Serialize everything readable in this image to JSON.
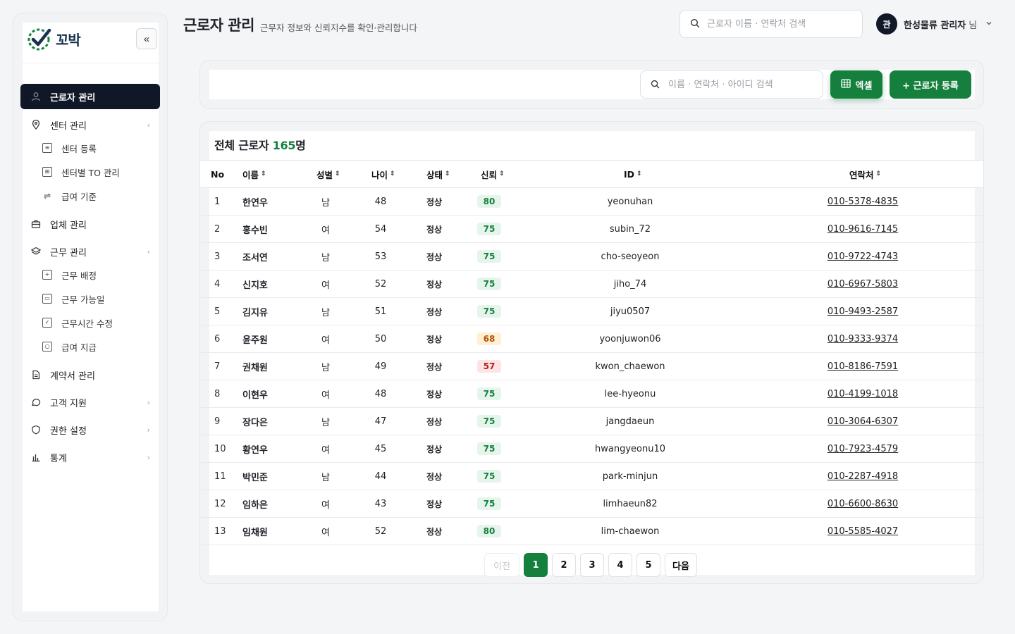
{
  "brand": {
    "name": "꼬박"
  },
  "sidebar": {
    "collapse_label": "«",
    "items": [
      {
        "label": "근로자 관리",
        "icon": "user-icon",
        "active": true
      },
      {
        "label": "센터 관리",
        "icon": "map-pin-icon",
        "chevron": "‹"
      },
      {
        "label": "센터 등록",
        "icon": "document-icon",
        "sub": true
      },
      {
        "label": "센터별 TO 관리",
        "icon": "table-icon",
        "sub": true
      },
      {
        "label": "급여 기준",
        "icon": "sliders-icon",
        "sub": true
      },
      {
        "label": "업체 관리",
        "icon": "briefcase-icon"
      },
      {
        "label": "근무 관리",
        "icon": "layers-icon",
        "chevron": "‹"
      },
      {
        "label": "근무 배정",
        "icon": "plus-square-icon",
        "sub": true
      },
      {
        "label": "근무 가능일",
        "icon": "calendar-icon",
        "sub": true
      },
      {
        "label": "근무시간 수정",
        "icon": "check-square-icon",
        "sub": true
      },
      {
        "label": "급여 지급",
        "icon": "cash-icon",
        "sub": true
      },
      {
        "label": "계약서 관리",
        "icon": "file-icon"
      },
      {
        "label": "고객 지원",
        "icon": "chat-icon",
        "chevron": "›"
      },
      {
        "label": "권한 설정",
        "icon": "shield-icon",
        "chevron": "›"
      },
      {
        "label": "통계",
        "icon": "bar-chart-icon",
        "chevron": "›"
      }
    ]
  },
  "header": {
    "title": "근로자 관리",
    "subtitle": "근무자 정보와 신뢰지수를 확인·관리합니다",
    "search_placeholder": "근로자 이름 · 연락처 검색",
    "user_initial": "관",
    "user_name": "한성물류 관리자",
    "user_suffix": "님"
  },
  "toolbar": {
    "search_placeholder": "이름 · 연락처 · 아이디 검색",
    "excel_label": "엑셀",
    "add_label": "+ 근로자 등록"
  },
  "table": {
    "total_label": "전체 근로자",
    "total_count": "165",
    "total_unit": "명",
    "columns": [
      "No",
      "이름",
      "성별",
      "나이",
      "상태",
      "신뢰",
      "ID",
      "연락처"
    ],
    "rows": [
      {
        "no": "1",
        "name": "한연우",
        "gender": "남",
        "age": "48",
        "status": "정상",
        "trust": "80",
        "id": "yeonuhan",
        "phone": "010-5378-4835"
      },
      {
        "no": "2",
        "name": "홍수빈",
        "gender": "여",
        "age": "54",
        "status": "정상",
        "trust": "75",
        "id": "subin_72",
        "phone": "010-9616-7145"
      },
      {
        "no": "3",
        "name": "조서연",
        "gender": "남",
        "age": "53",
        "status": "정상",
        "trust": "75",
        "id": "cho-seoyeon",
        "phone": "010-9722-4743"
      },
      {
        "no": "4",
        "name": "신지호",
        "gender": "여",
        "age": "52",
        "status": "정상",
        "trust": "75",
        "id": "jiho_74",
        "phone": "010-6967-5803"
      },
      {
        "no": "5",
        "name": "김지유",
        "gender": "남",
        "age": "51",
        "status": "정상",
        "trust": "75",
        "id": "jiyu0507",
        "phone": "010-9493-2587"
      },
      {
        "no": "6",
        "name": "윤주원",
        "gender": "여",
        "age": "50",
        "status": "정상",
        "trust": "68",
        "id": "yoonjuwon06",
        "phone": "010-9333-9374"
      },
      {
        "no": "7",
        "name": "권채원",
        "gender": "남",
        "age": "49",
        "status": "정상",
        "trust": "57",
        "id": "kwon_chaewon",
        "phone": "010-8186-7591"
      },
      {
        "no": "8",
        "name": "이현우",
        "gender": "여",
        "age": "48",
        "status": "정상",
        "trust": "75",
        "id": "lee-hyeonu",
        "phone": "010-4199-1018"
      },
      {
        "no": "9",
        "name": "장다은",
        "gender": "남",
        "age": "47",
        "status": "정상",
        "trust": "75",
        "id": "jangdaeun",
        "phone": "010-3064-6307"
      },
      {
        "no": "10",
        "name": "황연우",
        "gender": "여",
        "age": "45",
        "status": "정상",
        "trust": "75",
        "id": "hwangyeonu10",
        "phone": "010-7923-4579"
      },
      {
        "no": "11",
        "name": "박민준",
        "gender": "남",
        "age": "44",
        "status": "정상",
        "trust": "75",
        "id": "park-minjun",
        "phone": "010-2287-4918"
      },
      {
        "no": "12",
        "name": "임하은",
        "gender": "여",
        "age": "43",
        "status": "정상",
        "trust": "75",
        "id": "limhaeun82",
        "phone": "010-6600-8630"
      },
      {
        "no": "13",
        "name": "임채원",
        "gender": "여",
        "age": "52",
        "status": "정상",
        "trust": "80",
        "id": "lim-chaewon",
        "phone": "010-5585-4027"
      }
    ]
  },
  "pagination": {
    "prev_label": "이전",
    "pages": [
      "1",
      "2",
      "3",
      "4",
      "5"
    ],
    "current": "1",
    "next_label": "다음"
  },
  "colors": {
    "accent": "#15803d",
    "sidebar_active": "#101828",
    "trust_high": "#15803d",
    "trust_mid": "#b45309",
    "trust_low": "#b91c1c"
  }
}
